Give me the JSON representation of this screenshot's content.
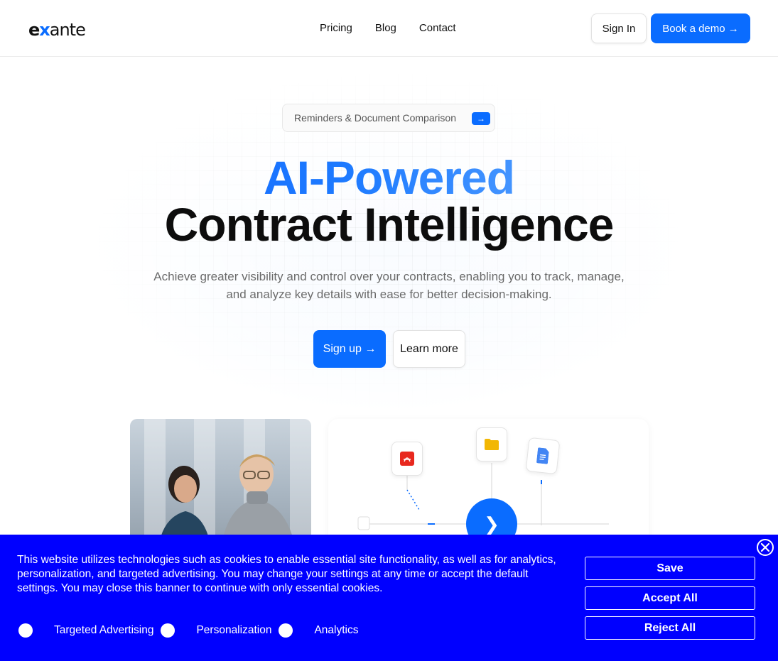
{
  "header": {
    "logo": {
      "e": "e",
      "x": "x",
      "rest": "ante"
    },
    "nav": [
      "Pricing",
      "Blog",
      "Contact"
    ],
    "signin_label": "Sign In",
    "demo_label": "Book a demo →"
  },
  "hero": {
    "pill_label": "Reminders & Document Comparison",
    "pill_arrow": "→",
    "title_line1": "AI-Powered",
    "title_line2": "Contract Intelligence",
    "subtitle": "Achieve greater visibility and control over your contracts, enabling you to track, manage, and analyze key details with ease for better decision-making.",
    "signup_label": "Sign up →",
    "learn_label": "Learn more"
  },
  "diagram": {
    "center_glyph": "❯",
    "icons": [
      "pdf-icon",
      "folder-icon",
      "google-docs-icon"
    ]
  },
  "cookie": {
    "text": "This website utilizes technologies such as cookies to enable essential site functionality, as well as for analytics, personalization, and targeted advertising. You may change your settings at any time or accept the default settings. You may close this banner to continue with only essential cookies.",
    "toggles": [
      "Targeted Advertising",
      "Personalization",
      "Analytics"
    ],
    "save_label": "Save",
    "accept_label": "Accept All",
    "reject_label": "Reject All"
  },
  "colors": {
    "accent": "#0a6cff",
    "banner": "#0000ff"
  }
}
